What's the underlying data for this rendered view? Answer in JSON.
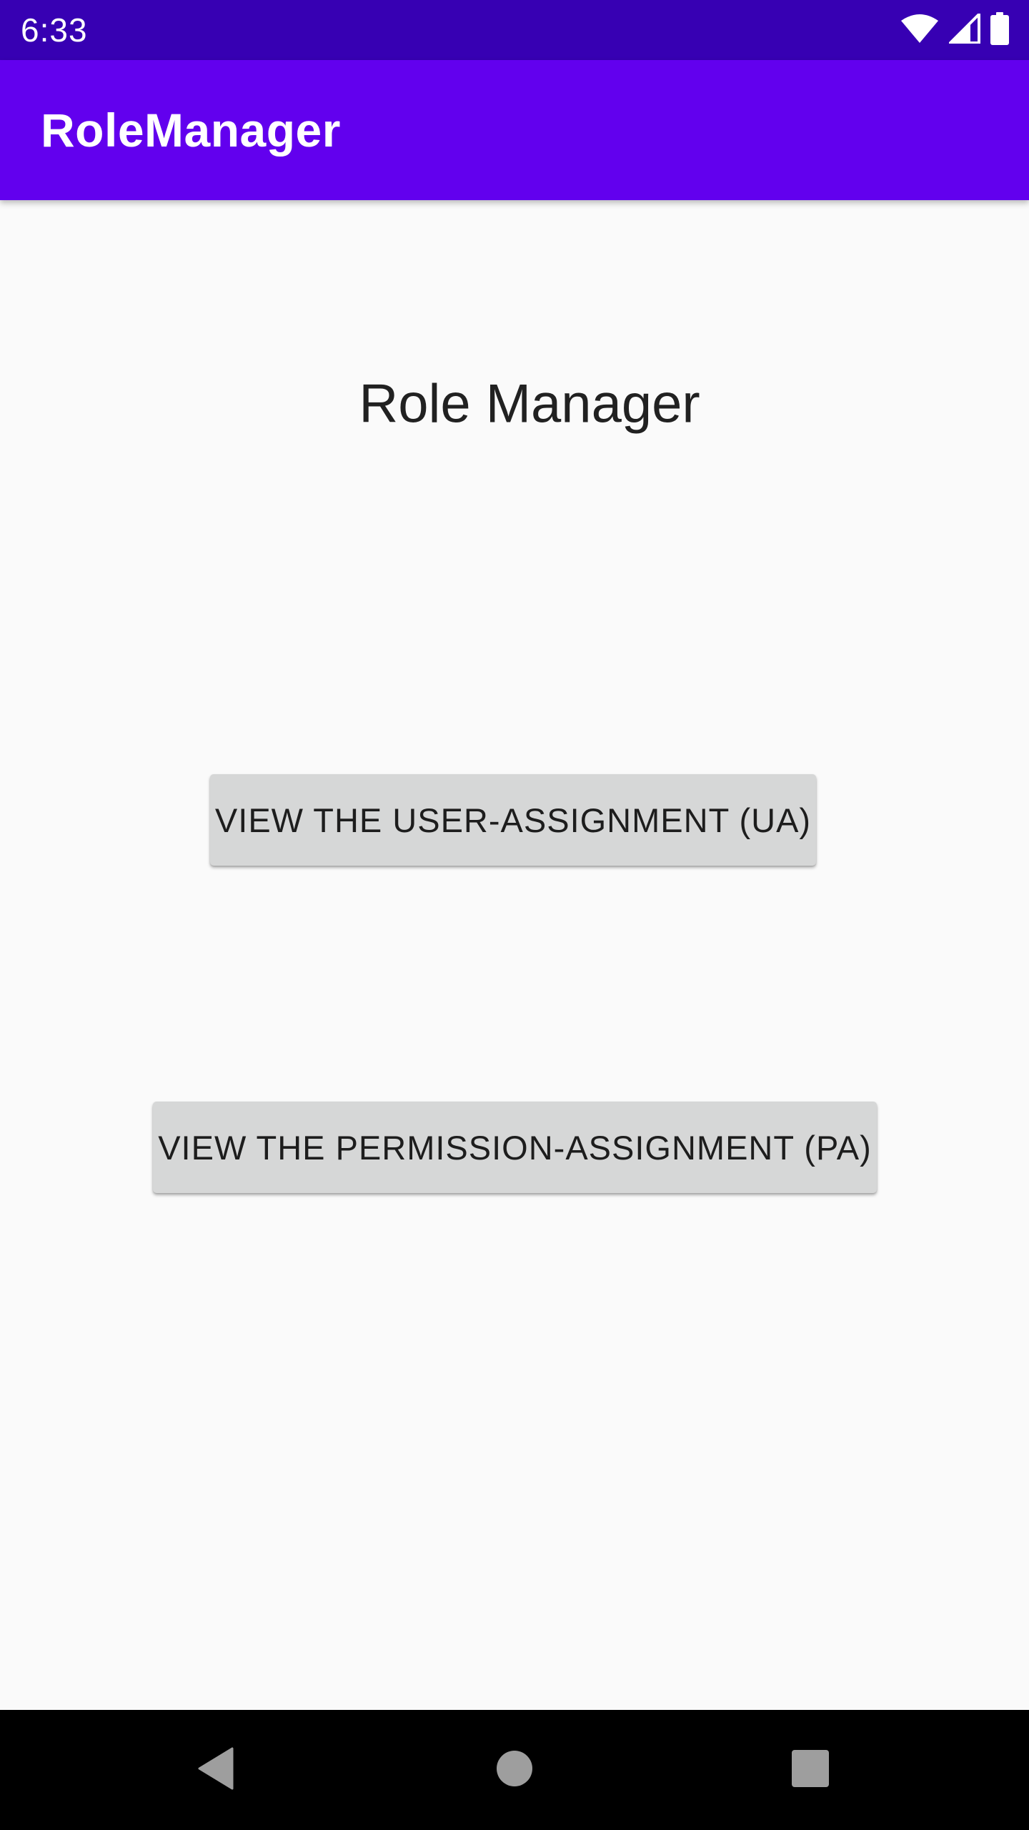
{
  "status_bar": {
    "time": "6:33",
    "icons": [
      "wifi-icon",
      "cellular-signal-icon",
      "battery-icon"
    ]
  },
  "app_bar": {
    "title": "RoleManager"
  },
  "main": {
    "heading": "Role Manager",
    "buttons": {
      "user_assignment": "VIEW THE USER-ASSIGNMENT (UA)",
      "permission_assignment": "VIEW THE PERMISSION-ASSIGNMENT (PA)"
    }
  },
  "nav_bar": {
    "icons": [
      "back-icon",
      "home-icon",
      "recents-icon"
    ]
  },
  "colors": {
    "status_bar": "#3700b3",
    "app_bar": "#6200ee",
    "background": "#fafafa",
    "button": "#d6d7d7",
    "nav_bar": "#000000"
  }
}
